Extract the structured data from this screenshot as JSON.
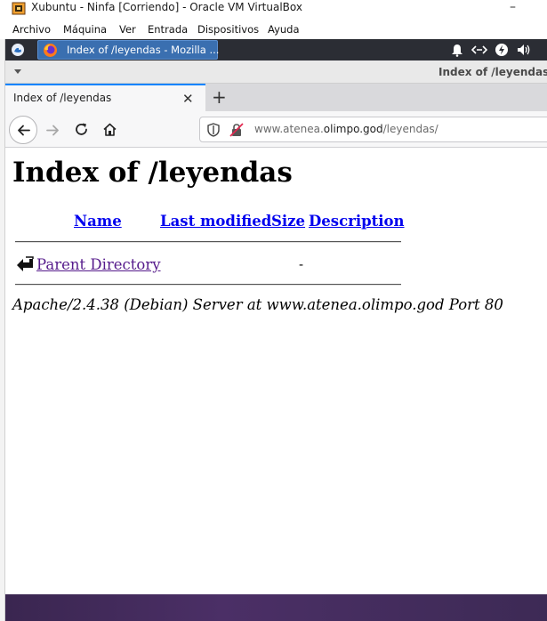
{
  "host_window": {
    "title": "Xubuntu - Ninfa [Corriendo] - Oracle VM VirtualBox",
    "minimize_symbol": "–",
    "menu": [
      "Archivo",
      "Máquina",
      "Ver",
      "Entrada",
      "Dispositivos",
      "Ayuda"
    ]
  },
  "guest_panel": {
    "taskbar_item": "Index of /leyendas - Mozilla ...",
    "tray_icons": [
      "notification-bell-icon",
      "network-icon",
      "power-icon",
      "volume-icon"
    ]
  },
  "browser": {
    "window_title": "Index of /leyendas -",
    "tab_label": "Index of /leyendas",
    "tab_close": "✕",
    "new_tab": "+",
    "url_prefix": "www.atenea.",
    "url_domain": "olimpo.god",
    "url_path": "/leyendas/"
  },
  "page": {
    "title": "Index of /leyendas",
    "columns": {
      "name": "Name",
      "last_modified": "Last modified",
      "size": "Size",
      "description": "Description"
    },
    "rows": [
      {
        "name": "Parent Directory",
        "last_modified": "",
        "size": "-",
        "description": ""
      }
    ],
    "server_signature": "Apache/2.4.38 (Debian) Server at www.atenea.olimpo.god Port 80"
  },
  "colors": {
    "link": "#0000ee",
    "visited_link": "#551a8b",
    "tab_accent": "#0a84ff",
    "panel_bg": "#2b2d34",
    "task_active": "#3a6fb0"
  }
}
